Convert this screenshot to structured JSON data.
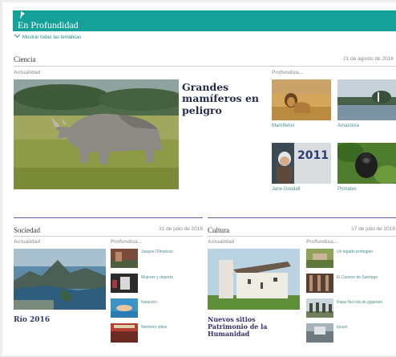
{
  "header": {
    "title": "En Profundidad",
    "show_all": "Mostrar todas las temáticas"
  },
  "ciencia": {
    "title": "Ciencia",
    "date": "21 de agosto de 2016",
    "actualidad_label": "Actualidad",
    "profundiza_label": "Profundiza...",
    "headline": [
      "Grandes",
      "mamíferos en",
      "peligro"
    ],
    "items": [
      {
        "label": "Mamíferos"
      },
      {
        "label": "Amazonía"
      },
      {
        "label": "Jane Goodall"
      },
      {
        "label": "Primates"
      }
    ]
  },
  "sociedad": {
    "title": "Sociedad",
    "date": "31 de julio de 2016",
    "actualidad_label": "Actualidad",
    "profundiza_label": "Profundiza...",
    "headline": "Río 2016",
    "items": [
      {
        "label": "Juegos Olímpicos"
      },
      {
        "label": "Mujeres y deporte"
      },
      {
        "label": "Natación"
      },
      {
        "label": "Nérmero sitios"
      }
    ]
  },
  "cultura": {
    "title": "Cultura",
    "date": "17 de julio de 2016",
    "actualidad_label": "Actualidad",
    "profundiza_label": "Profundiza...",
    "headline": [
      "Nuevos sitios",
      "Patrimonio de la",
      "Humanidad"
    ],
    "items": [
      {
        "label": "Un legado protegido"
      },
      {
        "label": "El Camino de Santiago"
      },
      {
        "label": "Rapa Nui isla de gigantes"
      },
      {
        "label": "Ipsum"
      }
    ]
  },
  "colors": {
    "brand": "#15a19a",
    "headline": "#232c49",
    "culture_headline": "#3a2b6b",
    "link": "#4a8f8b"
  }
}
